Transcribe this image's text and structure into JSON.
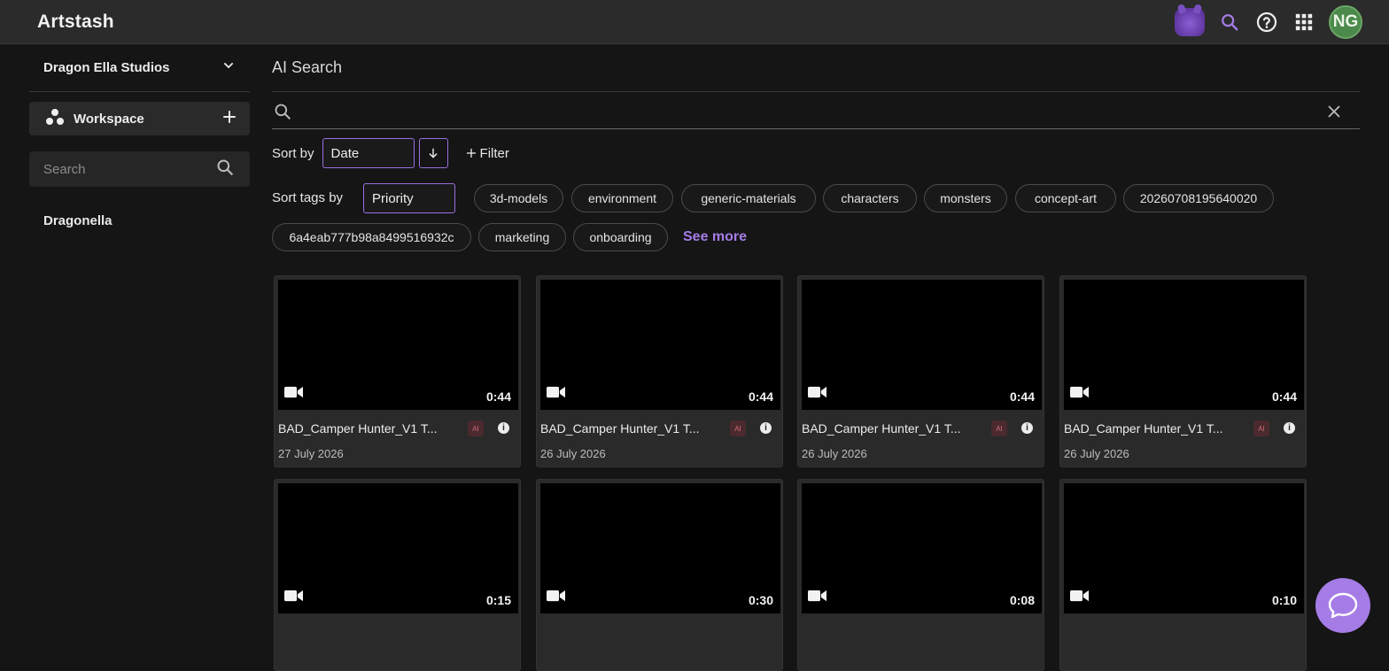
{
  "app": {
    "title": "Artstash",
    "avatar_initials": "NG"
  },
  "colors": {
    "accent": "#a57ce6",
    "background": "#151515",
    "topbar": "#2b2b2b",
    "avatar": "#4b8a4a"
  },
  "sidebar": {
    "org_name": "Dragon Ella Studios",
    "workspace_label": "Workspace",
    "search_placeholder": "Search",
    "items": [
      {
        "label": "Dragonella"
      }
    ]
  },
  "main": {
    "title": "AI Search",
    "search_value": "",
    "sort_label": "Sort by",
    "sort_value": "Date",
    "filter_label": "Filter",
    "sort_tags_label": "Sort tags by",
    "sort_tags_value": "Priority",
    "tags": [
      "3d-models",
      "environment",
      "generic-materials",
      "characters",
      "monsters",
      "concept-art",
      "20260708195640020",
      "6a4eab777b98a8499516932c",
      "marketing",
      "onboarding"
    ],
    "see_more_label": "See more"
  },
  "assets": [
    {
      "title": "BAD_Camper Hunter_V1 T...",
      "duration": "0:44",
      "date": "27 July 2026",
      "badge": "AI"
    },
    {
      "title": "BAD_Camper Hunter_V1 T...",
      "duration": "0:44",
      "date": "26 July 2026",
      "badge": "AI"
    },
    {
      "title": "BAD_Camper Hunter_V1 T...",
      "duration": "0:44",
      "date": "26 July 2026",
      "badge": "AI"
    },
    {
      "title": "BAD_Camper Hunter_V1 T...",
      "duration": "0:44",
      "date": "26 July 2026",
      "badge": "AI"
    },
    {
      "duration": "0:15"
    },
    {
      "duration": "0:30"
    },
    {
      "duration": "0:08"
    },
    {
      "duration": "0:10"
    }
  ]
}
